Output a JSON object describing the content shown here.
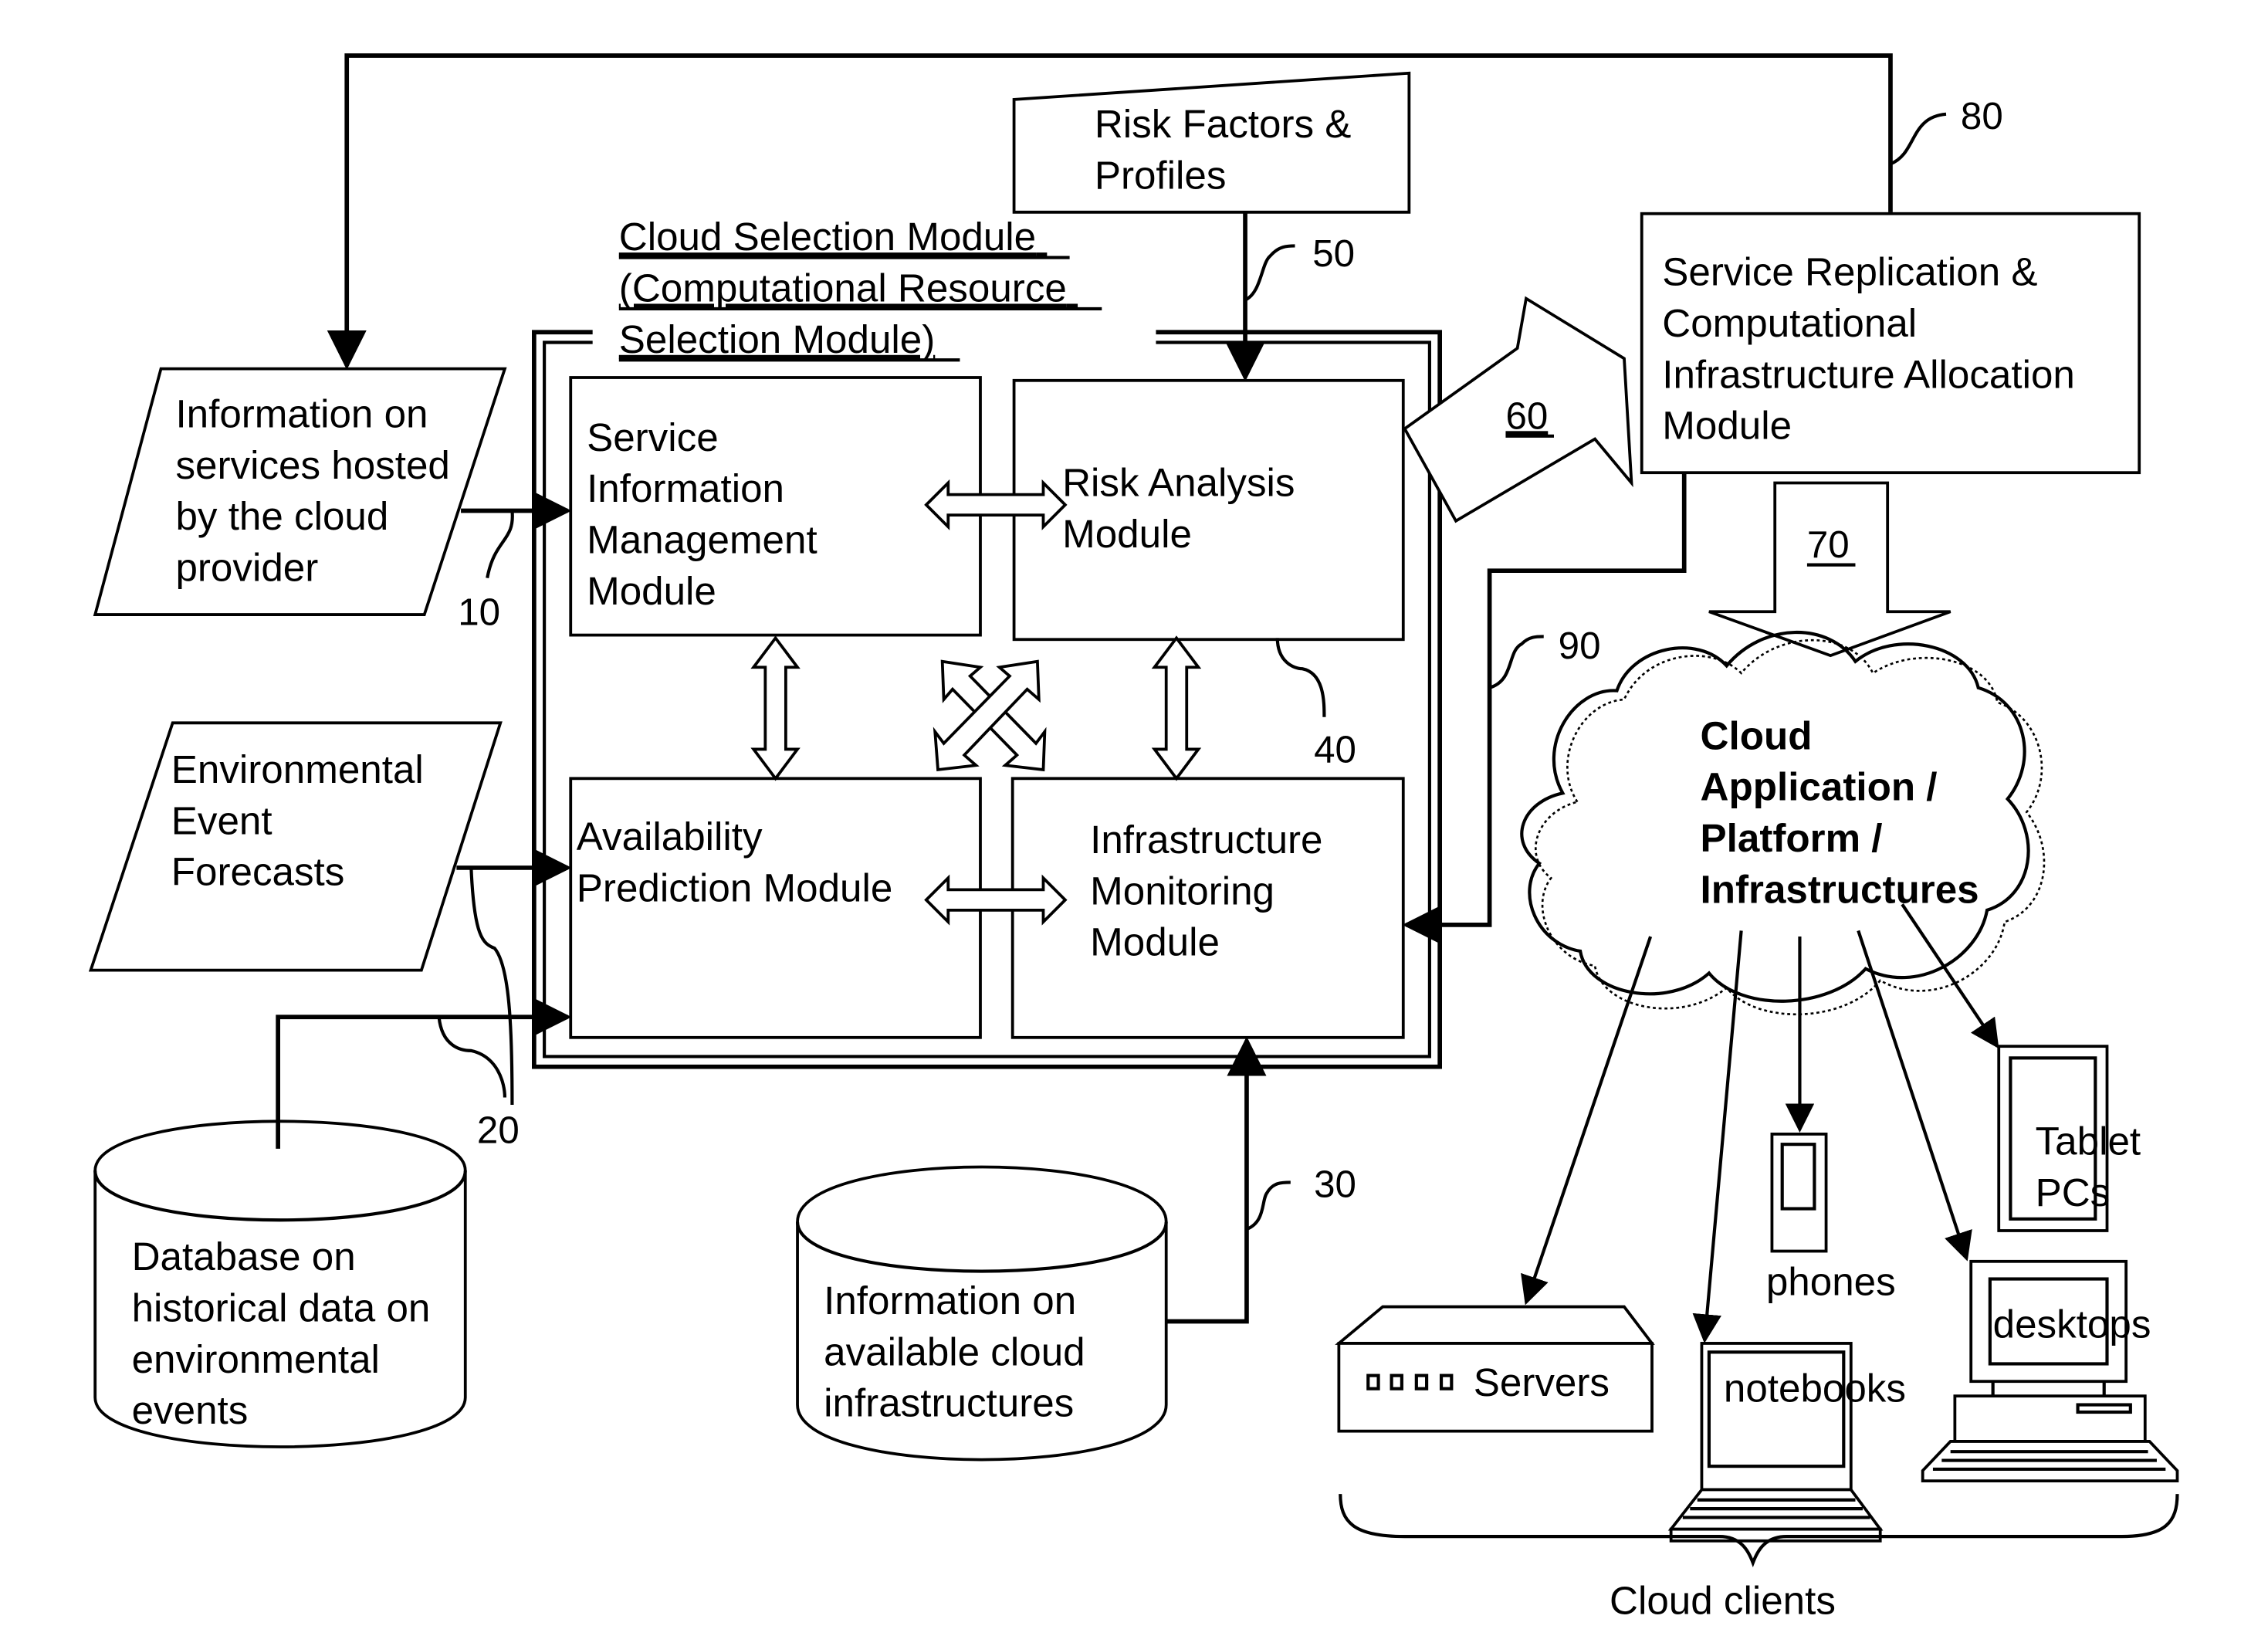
{
  "colors": {
    "ink": "#000000",
    "paper": "#ffffff"
  },
  "inputs": {
    "services_info": {
      "lines": [
        "Information on",
        "services hosted",
        "by the cloud",
        "provider"
      ],
      "ref": "10"
    },
    "env_forecasts": {
      "lines": [
        "Environmental",
        "Event",
        "Forecasts"
      ]
    },
    "historical_db": {
      "lines": [
        "Database on",
        "historical data on",
        "environmental",
        "events"
      ],
      "ref": "20"
    },
    "infra_db": {
      "lines": [
        "Information on",
        "available cloud",
        "infrastructures"
      ],
      "ref": "30"
    },
    "risk_factors": {
      "lines": [
        "Risk Factors &",
        "Profiles"
      ],
      "ref": "50"
    }
  },
  "selection_module": {
    "title_lines": [
      "Cloud Selection Module",
      "(Computational Resource",
      "Selection Module)"
    ],
    "ref": "40",
    "modules": [
      {
        "id": "service-info",
        "lines": [
          "Service",
          "Information",
          "Management",
          "Module"
        ]
      },
      {
        "id": "risk-analysis",
        "lines": [
          "Risk Analysis",
          "Module"
        ]
      },
      {
        "id": "availability",
        "lines": [
          "Availability",
          "Prediction Module"
        ]
      },
      {
        "id": "infra-monitoring",
        "lines": [
          "Infrastructure",
          "Monitoring",
          "Module"
        ]
      }
    ]
  },
  "output_arrow": {
    "ref": "60"
  },
  "allocation_module": {
    "lines": [
      "Service Replication &",
      "Computational",
      "Infrastructure Allocation",
      "Module"
    ]
  },
  "deploy_arrow": {
    "ref": "70"
  },
  "feedback": {
    "top_ref": "80",
    "monitor_ref": "90"
  },
  "cloud": {
    "lines": [
      "Cloud",
      "Application /",
      "Platform /",
      "Infrastructures"
    ]
  },
  "clients": {
    "servers": "Servers",
    "notebooks": "notebooks",
    "phones": "phones",
    "desktops": "desktops",
    "tablets_lines": [
      "Tablet",
      "PCs"
    ],
    "group_label": "Cloud clients"
  }
}
